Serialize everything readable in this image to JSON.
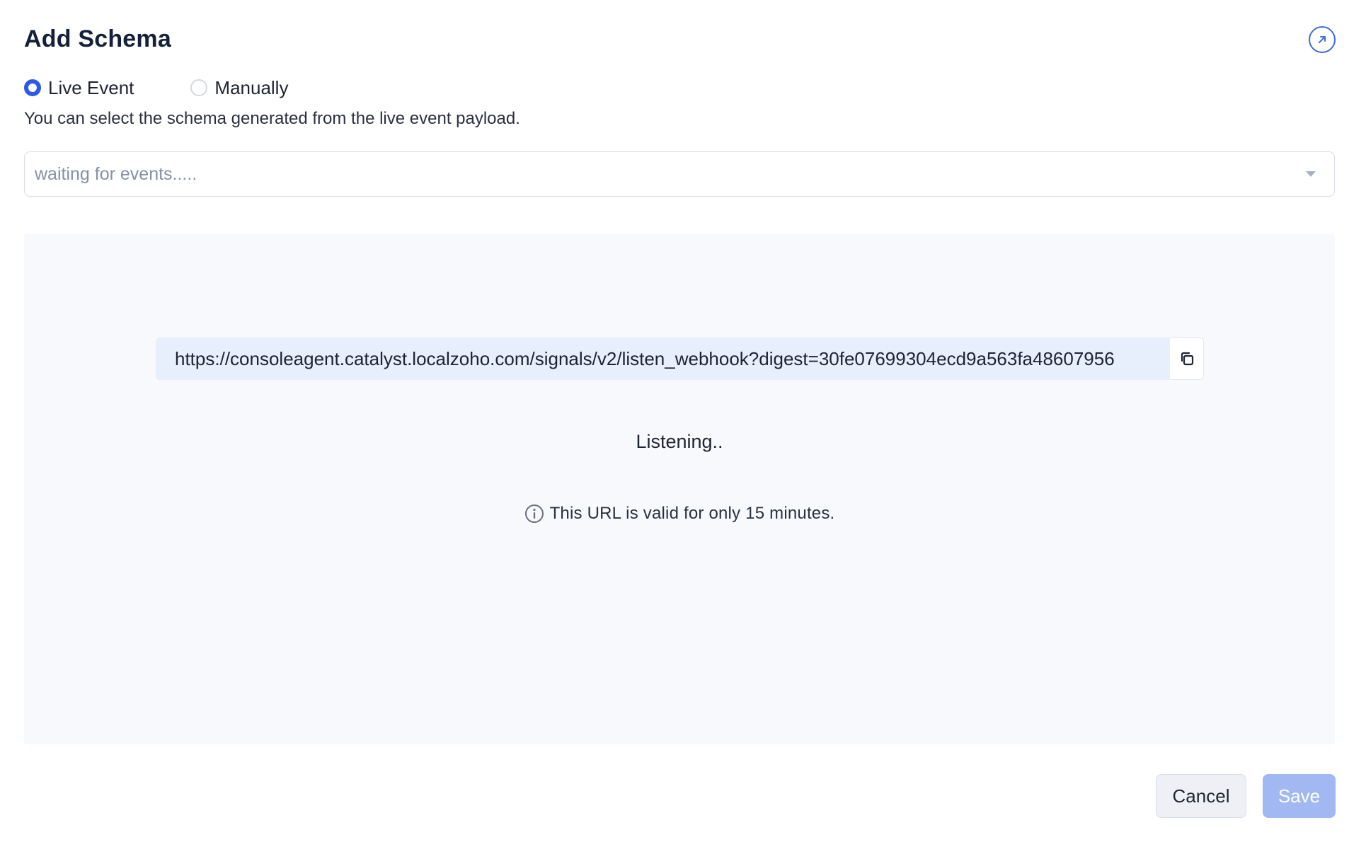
{
  "dialog": {
    "title": "Add Schema",
    "expand_icon": "arrow-up-right-circle-icon"
  },
  "source_options": [
    {
      "label": "Live Event",
      "selected": true
    },
    {
      "label": "Manually",
      "selected": false
    }
  ],
  "description": "You can select the schema generated from the live event payload.",
  "event_select": {
    "placeholder": "waiting for events.....",
    "caret_icon": "caret-down-icon"
  },
  "listener": {
    "url": "https://consoleagent.catalyst.localzoho.com/signals/v2/listen_webhook?digest=30fe07699304ecd9a563fa48607956",
    "copy_icon": "copy-icon",
    "status": "Listening..",
    "info_icon": "info-icon",
    "validity_note": "This URL is valid for only 15 minutes."
  },
  "footer": {
    "cancel_label": "Cancel",
    "save_label": "Save",
    "save_disabled": true
  },
  "colors": {
    "primary": "#2c5ae6",
    "save_disabled_bg": "#a2b8f3",
    "url_bg": "#e7eefc",
    "panel_bg": "#f8f9fc"
  }
}
